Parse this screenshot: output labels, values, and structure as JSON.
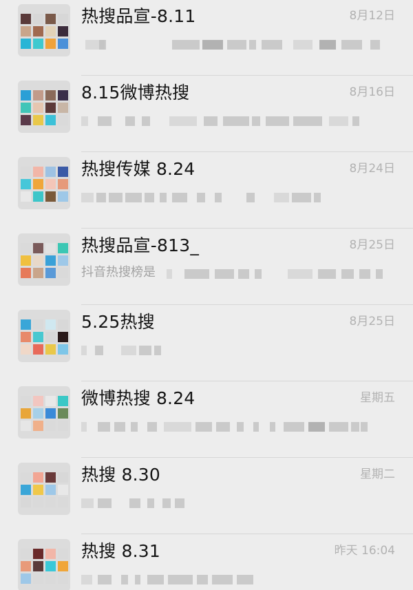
{
  "chats": [
    {
      "title": "热搜品宣-8.11",
      "time": "8月12日",
      "preview": "",
      "avatar_colors": [
        "#5a3a3a",
        "#d7d7d7",
        "#7a5a4a",
        "#d7d7d7",
        "#c9a58b",
        "#a06a50",
        "#e2d2b8",
        "#3b2b3b",
        "#29b5d6",
        "#3ec9cf",
        "#f0a23a",
        "#4a90d9"
      ],
      "blur": [
        [
          6,
          28,
          "l"
        ],
        [
          26,
          10,
          ""
        ],
        [
          132,
          40,
          ""
        ],
        [
          176,
          30,
          "d"
        ],
        [
          212,
          28,
          ""
        ],
        [
          244,
          10,
          ""
        ],
        [
          262,
          30,
          ""
        ],
        [
          308,
          28,
          "l"
        ],
        [
          346,
          24,
          "d"
        ],
        [
          378,
          30,
          ""
        ],
        [
          420,
          14,
          ""
        ]
      ]
    },
    {
      "title": "8.15微博热搜",
      "time": "8月16日",
      "preview": "",
      "avatar_colors": [
        "#2a9fd6",
        "#c29b8a",
        "#8a6a5a",
        "#3b2f4a",
        "#41c5b8",
        "#e5c6b0",
        "#5c3a3a",
        "#c8b6a6",
        "#5b3a4a",
        "#e9c84a",
        "#3cc1d8",
        "#dadada"
      ],
      "blur": [
        [
          0,
          10,
          "l"
        ],
        [
          24,
          20,
          ""
        ],
        [
          64,
          14,
          ""
        ],
        [
          88,
          12,
          ""
        ],
        [
          128,
          40,
          "l"
        ],
        [
          178,
          20,
          ""
        ],
        [
          206,
          38,
          ""
        ],
        [
          248,
          12,
          ""
        ],
        [
          268,
          34,
          ""
        ],
        [
          308,
          42,
          ""
        ],
        [
          360,
          28,
          "l"
        ],
        [
          394,
          10,
          ""
        ]
      ]
    },
    {
      "title": "热搜传媒 8.24",
      "time": "8月24日",
      "preview": "",
      "avatar_colors": [
        "#dadada",
        "#f2b6a8",
        "#9ec2e3",
        "#3b5aa6",
        "#46c7d9",
        "#f0a63a",
        "#f4c6b8",
        "#e69a7a",
        "#e8e8e8",
        "#3cc6c9",
        "#7a5a3a",
        "#9ec8e8"
      ],
      "blur": [
        [
          0,
          18,
          "l"
        ],
        [
          22,
          14,
          ""
        ],
        [
          40,
          20,
          ""
        ],
        [
          64,
          24,
          ""
        ],
        [
          92,
          14,
          ""
        ],
        [
          114,
          10,
          ""
        ],
        [
          132,
          22,
          ""
        ],
        [
          168,
          12,
          ""
        ],
        [
          194,
          10,
          ""
        ],
        [
          240,
          12,
          ""
        ],
        [
          280,
          22,
          "l"
        ],
        [
          306,
          28,
          ""
        ],
        [
          338,
          10,
          ""
        ]
      ]
    },
    {
      "title": "热搜品宣-813_",
      "time": "8月25日",
      "preview": "抖音热搜榜是",
      "avatar_colors": [
        "#dadada",
        "#7a5a5a",
        "#e2e2e2",
        "#3cc7b4",
        "#f0c040",
        "#e8d8c8",
        "#3aa1d8",
        "#9ec8e8",
        "#e67a5a",
        "#c9a58b",
        "#5a9ad8",
        "#dadada"
      ],
      "blur": [
        [
          124,
          8,
          "l"
        ],
        [
          150,
          36,
          ""
        ],
        [
          194,
          28,
          ""
        ],
        [
          228,
          16,
          ""
        ],
        [
          252,
          10,
          ""
        ],
        [
          300,
          36,
          "l"
        ],
        [
          344,
          26,
          ""
        ],
        [
          378,
          18,
          ""
        ],
        [
          404,
          16,
          ""
        ],
        [
          428,
          10,
          ""
        ]
      ]
    },
    {
      "title": "5.25热搜",
      "time": "8月25日",
      "preview": "",
      "avatar_colors": [
        "#3aa6d8",
        "#d9d9d9",
        "#d0e8f0",
        "#d8d8d8",
        "#e88a6a",
        "#48c8d0",
        "#d7d7d7",
        "#2a1a1a",
        "#f0d8c8",
        "#e86a5a",
        "#e9c84a",
        "#7ec6e8"
      ],
      "blur": [
        [
          0,
          8,
          "l"
        ],
        [
          20,
          12,
          ""
        ],
        [
          58,
          22,
          "l"
        ],
        [
          84,
          18,
          ""
        ],
        [
          106,
          10,
          ""
        ]
      ]
    },
    {
      "title": "微博热搜 8.24",
      "time": "星期五",
      "preview": "",
      "avatar_colors": [
        "#dadada",
        "#f2c6c0",
        "#e8e8e8",
        "#3ac8c6",
        "#e8a63a",
        "#a6d0e8",
        "#3a8ad8",
        "#6a8a5a",
        "#e6e6e6",
        "#f0b08a",
        "#dadada",
        "#dadada"
      ],
      "blur": [
        [
          0,
          8,
          "l"
        ],
        [
          24,
          18,
          ""
        ],
        [
          48,
          16,
          ""
        ],
        [
          72,
          10,
          ""
        ],
        [
          96,
          14,
          ""
        ],
        [
          120,
          40,
          "l"
        ],
        [
          166,
          24,
          ""
        ],
        [
          196,
          20,
          ""
        ],
        [
          226,
          10,
          ""
        ],
        [
          250,
          8,
          ""
        ],
        [
          274,
          8,
          ""
        ],
        [
          294,
          30,
          ""
        ],
        [
          330,
          24,
          "d"
        ],
        [
          360,
          28,
          ""
        ],
        [
          392,
          12,
          ""
        ],
        [
          406,
          10,
          ""
        ]
      ]
    },
    {
      "title": "热搜 8.30",
      "time": "星期二",
      "preview": "",
      "avatar_colors": [
        "#dadada",
        "#f2a694",
        "#6a3a3a",
        "#d8d8d8",
        "#3aa6d8",
        "#f0c84a",
        "#9ec8e8",
        "#e8e8e8",
        "#d8d8d8",
        "#dadada",
        "#dadada",
        "#dadada"
      ],
      "blur": [
        [
          0,
          18,
          "l"
        ],
        [
          24,
          20,
          ""
        ],
        [
          70,
          16,
          ""
        ],
        [
          96,
          10,
          ""
        ],
        [
          118,
          12,
          ""
        ],
        [
          136,
          14,
          ""
        ]
      ]
    },
    {
      "title": "热搜 8.31",
      "time": "昨天 16:04",
      "preview": "",
      "avatar_colors": [
        "#dadada",
        "#6a2a2a",
        "#f2b6a8",
        "#dadada",
        "#e89a7a",
        "#5a3a3a",
        "#3ac8d8",
        "#f0a63a",
        "#9ec8e8",
        "#dadada",
        "#dadada",
        "#dadada"
      ],
      "blur": [
        [
          0,
          16,
          "l"
        ],
        [
          24,
          20,
          ""
        ],
        [
          58,
          10,
          ""
        ],
        [
          78,
          8,
          ""
        ],
        [
          96,
          24,
          ""
        ],
        [
          126,
          36,
          ""
        ],
        [
          168,
          16,
          ""
        ],
        [
          190,
          30,
          ""
        ],
        [
          226,
          24,
          ""
        ]
      ]
    }
  ]
}
